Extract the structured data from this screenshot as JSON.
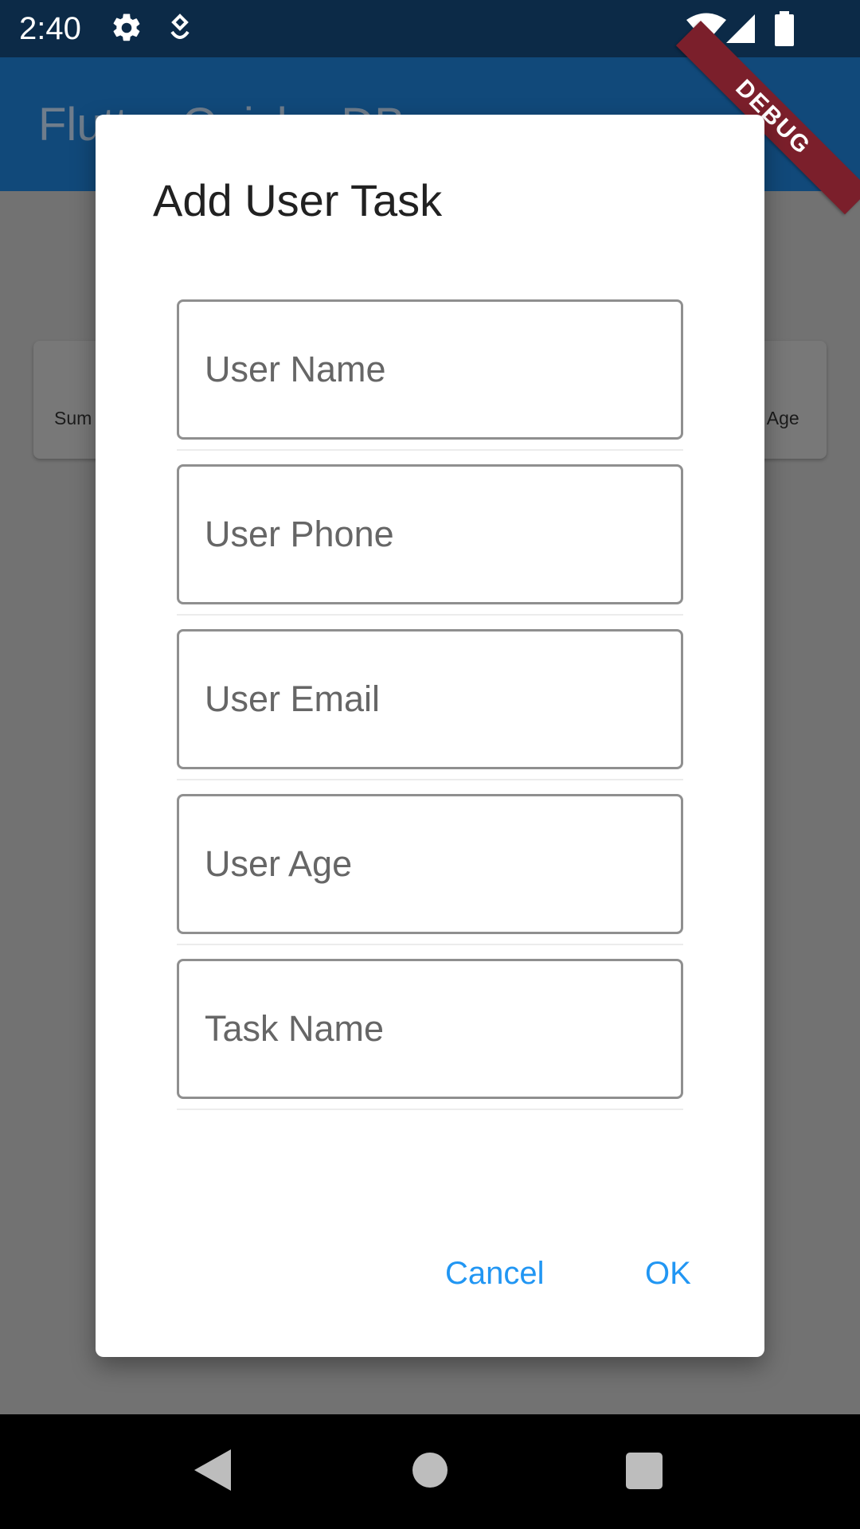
{
  "status_bar": {
    "time": "2:40",
    "icons": [
      "gear-icon",
      "assistant-icon",
      "wifi-icon",
      "signal-icon",
      "battery-icon"
    ]
  },
  "app_bar": {
    "title": "Flutter Quick - DB"
  },
  "debug_banner": "DEBUG",
  "background_card": {
    "left_text": "Sum",
    "right_text": "r Age"
  },
  "dialog": {
    "title": "Add User Task",
    "fields": [
      {
        "placeholder": "User Name",
        "value": ""
      },
      {
        "placeholder": "User Phone",
        "value": ""
      },
      {
        "placeholder": "User Email",
        "value": ""
      },
      {
        "placeholder": "User Age",
        "value": ""
      },
      {
        "placeholder": "Task Name",
        "value": ""
      }
    ],
    "cancel_label": "Cancel",
    "ok_label": "OK"
  },
  "colors": {
    "accent": "#2196f3",
    "status_bar": "#0c2a47",
    "app_bar": "#11497a",
    "scrim": "#727272",
    "debug_ribbon": "#7b1f2b"
  }
}
